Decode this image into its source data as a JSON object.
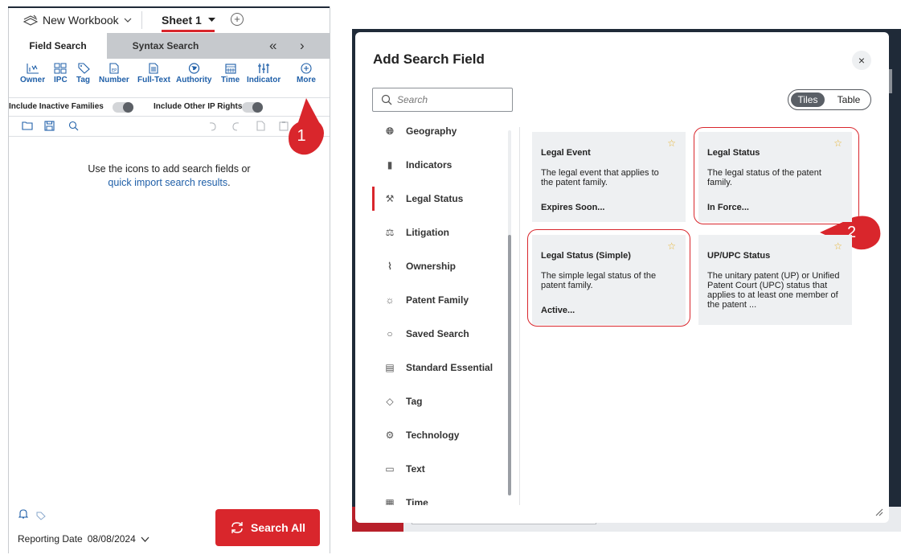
{
  "workbook": {
    "name": "New Workbook",
    "sheet": "Sheet 1"
  },
  "tabs": {
    "field_search": "Field Search",
    "syntax_search": "Syntax Search"
  },
  "toolbar": [
    "Owner",
    "IPC",
    "Tag",
    "Number",
    "Full-Text",
    "Authority",
    "Time",
    "Indicator",
    "More"
  ],
  "toggles": {
    "inactive": "Include Inactive Families",
    "other_ip": "Include Other IP Rights"
  },
  "hint": {
    "line1": "Use the icons to add search fields or",
    "link": "quick import search results",
    "tail": "."
  },
  "callouts": {
    "one": "1",
    "two": "2"
  },
  "bottom": {
    "reporting_label": "Reporting Date",
    "reporting_date": "08/08/2024",
    "search_all": "Search All"
  },
  "modal": {
    "title": "Add Search Field",
    "close": "×",
    "search_placeholder": "Search",
    "view_tiles": "Tiles",
    "view_table": "Table",
    "categories": [
      {
        "label": "Geography",
        "icon": "globe-icon"
      },
      {
        "label": "Indicators",
        "icon": "bar-chart-icon"
      },
      {
        "label": "Legal Status",
        "icon": "gavel-icon",
        "active": true
      },
      {
        "label": "Litigation",
        "icon": "scales-icon"
      },
      {
        "label": "Ownership",
        "icon": "ownership-icon"
      },
      {
        "label": "Patent Family",
        "icon": "lightbulb-icon"
      },
      {
        "label": "Saved Search",
        "icon": "search-icon"
      },
      {
        "label": "Standard Essential",
        "icon": "standard-doc-icon"
      },
      {
        "label": "Tag",
        "icon": "tag-icon"
      },
      {
        "label": "Technology",
        "icon": "technology-icon"
      },
      {
        "label": "Text",
        "icon": "document-icon"
      },
      {
        "label": "Time",
        "icon": "calendar-icon"
      }
    ],
    "tiles": [
      {
        "title": "Legal Event",
        "desc": "The legal event that applies to the patent family.",
        "value": "Expires Soon..."
      },
      {
        "title": "Legal Status",
        "desc": "The legal status of the patent family.",
        "value": "In Force..."
      },
      {
        "title": "Legal Status (Simple)",
        "desc": "The simple legal status of the patent family.",
        "value": "Active..."
      },
      {
        "title": "UP/UPC Status",
        "desc": "The unitary patent (UP) or Unified Patent Court (UPC) status that applies to at least one member of the patent ...",
        "value": ""
      }
    ],
    "colors": {
      "accent": "#d9262c",
      "link": "#1f5fa8",
      "star": "#e7b330"
    }
  }
}
